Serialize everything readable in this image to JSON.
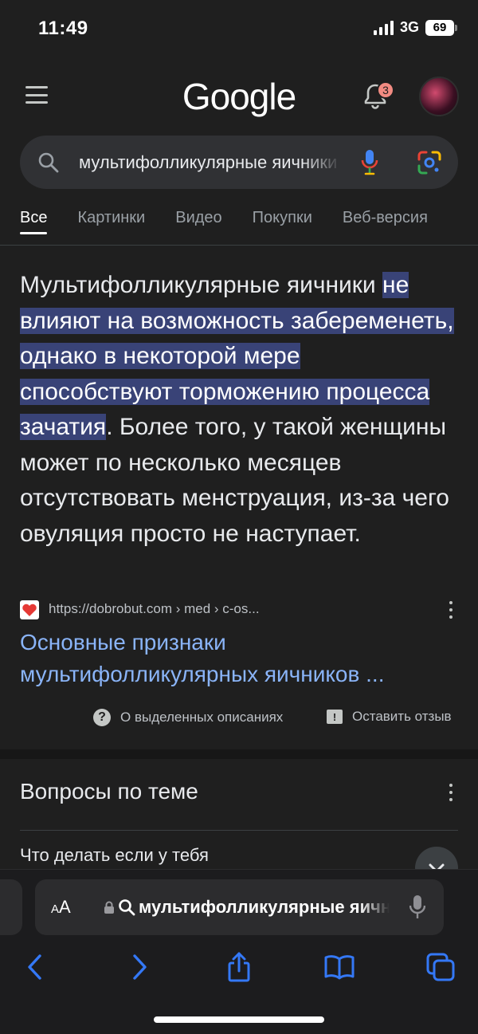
{
  "status_bar": {
    "time": "11:49",
    "network": "3G",
    "battery": "69"
  },
  "header": {
    "logo_text": "Google",
    "notification_count": "3"
  },
  "search": {
    "query": "мультифолликулярные яичники"
  },
  "tabs": [
    {
      "label": "Все",
      "active": true
    },
    {
      "label": "Картинки"
    },
    {
      "label": "Видео"
    },
    {
      "label": "Покупки"
    },
    {
      "label": "Веб-версия"
    }
  ],
  "featured_snippet": {
    "lead": "Мультифолликулярные яичники ",
    "highlight": "не влияют на возможность забеременеть, однако в некоторой мере способствуют торможению процесса зачатия",
    "tail": ". Более того, у такой женщины может по несколько месяцев отсутствовать менструация, из-за чего овуляция просто не наступает.",
    "source_url": "https://dobrobut.com › med › c-os...",
    "title": "Основные признаки мультифолликулярных яичников ...",
    "about_label": "О выделенных описаниях",
    "feedback_label": "Оставить отзыв"
  },
  "related_questions": {
    "title": "Вопросы по теме",
    "items": [
      "Что делать если у тебя"
    ]
  },
  "safari": {
    "aa_label": "AA",
    "address_text": "мультифолликулярные яичники"
  },
  "colors": {
    "background": "#1f1f1f",
    "highlight": "#394377",
    "link": "#8ab4f8",
    "safari_accent": "#3478f6"
  }
}
